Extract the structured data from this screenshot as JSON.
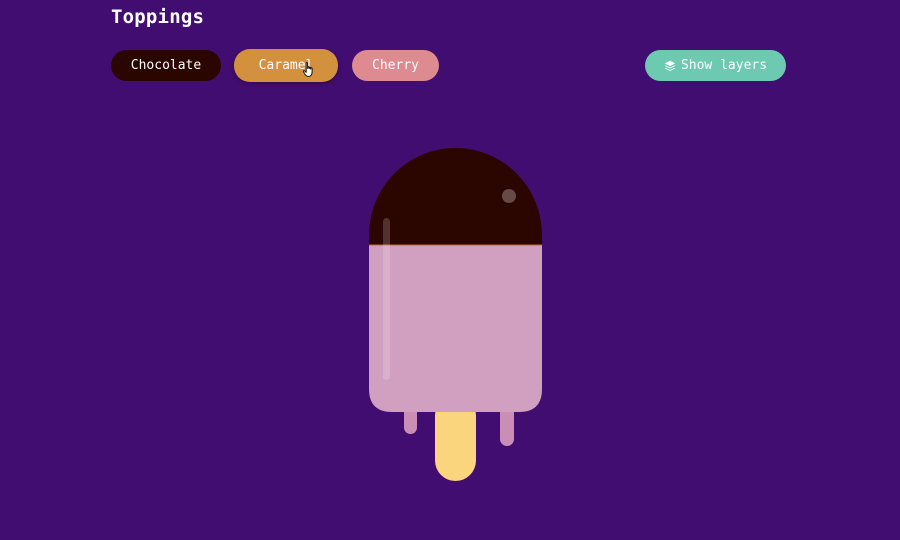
{
  "header": {
    "title": "Toppings"
  },
  "toppings": [
    {
      "label": "Chocolate",
      "color": "#2b0500"
    },
    {
      "label": "Caramel",
      "color": "#d3913e"
    },
    {
      "label": "Cherry",
      "color": "#dd8a91"
    }
  ],
  "selected_topping": "Chocolate",
  "show_layers": {
    "label": "Show layers",
    "color": "#6dcab1",
    "icon": "layers-icon"
  },
  "colors": {
    "background": "#420d70",
    "topping": "#2b0500",
    "ice_cream": "#d19fc0",
    "drip": "#c98db6",
    "stick": "#fbd47e",
    "highlight": "#ffffff"
  }
}
